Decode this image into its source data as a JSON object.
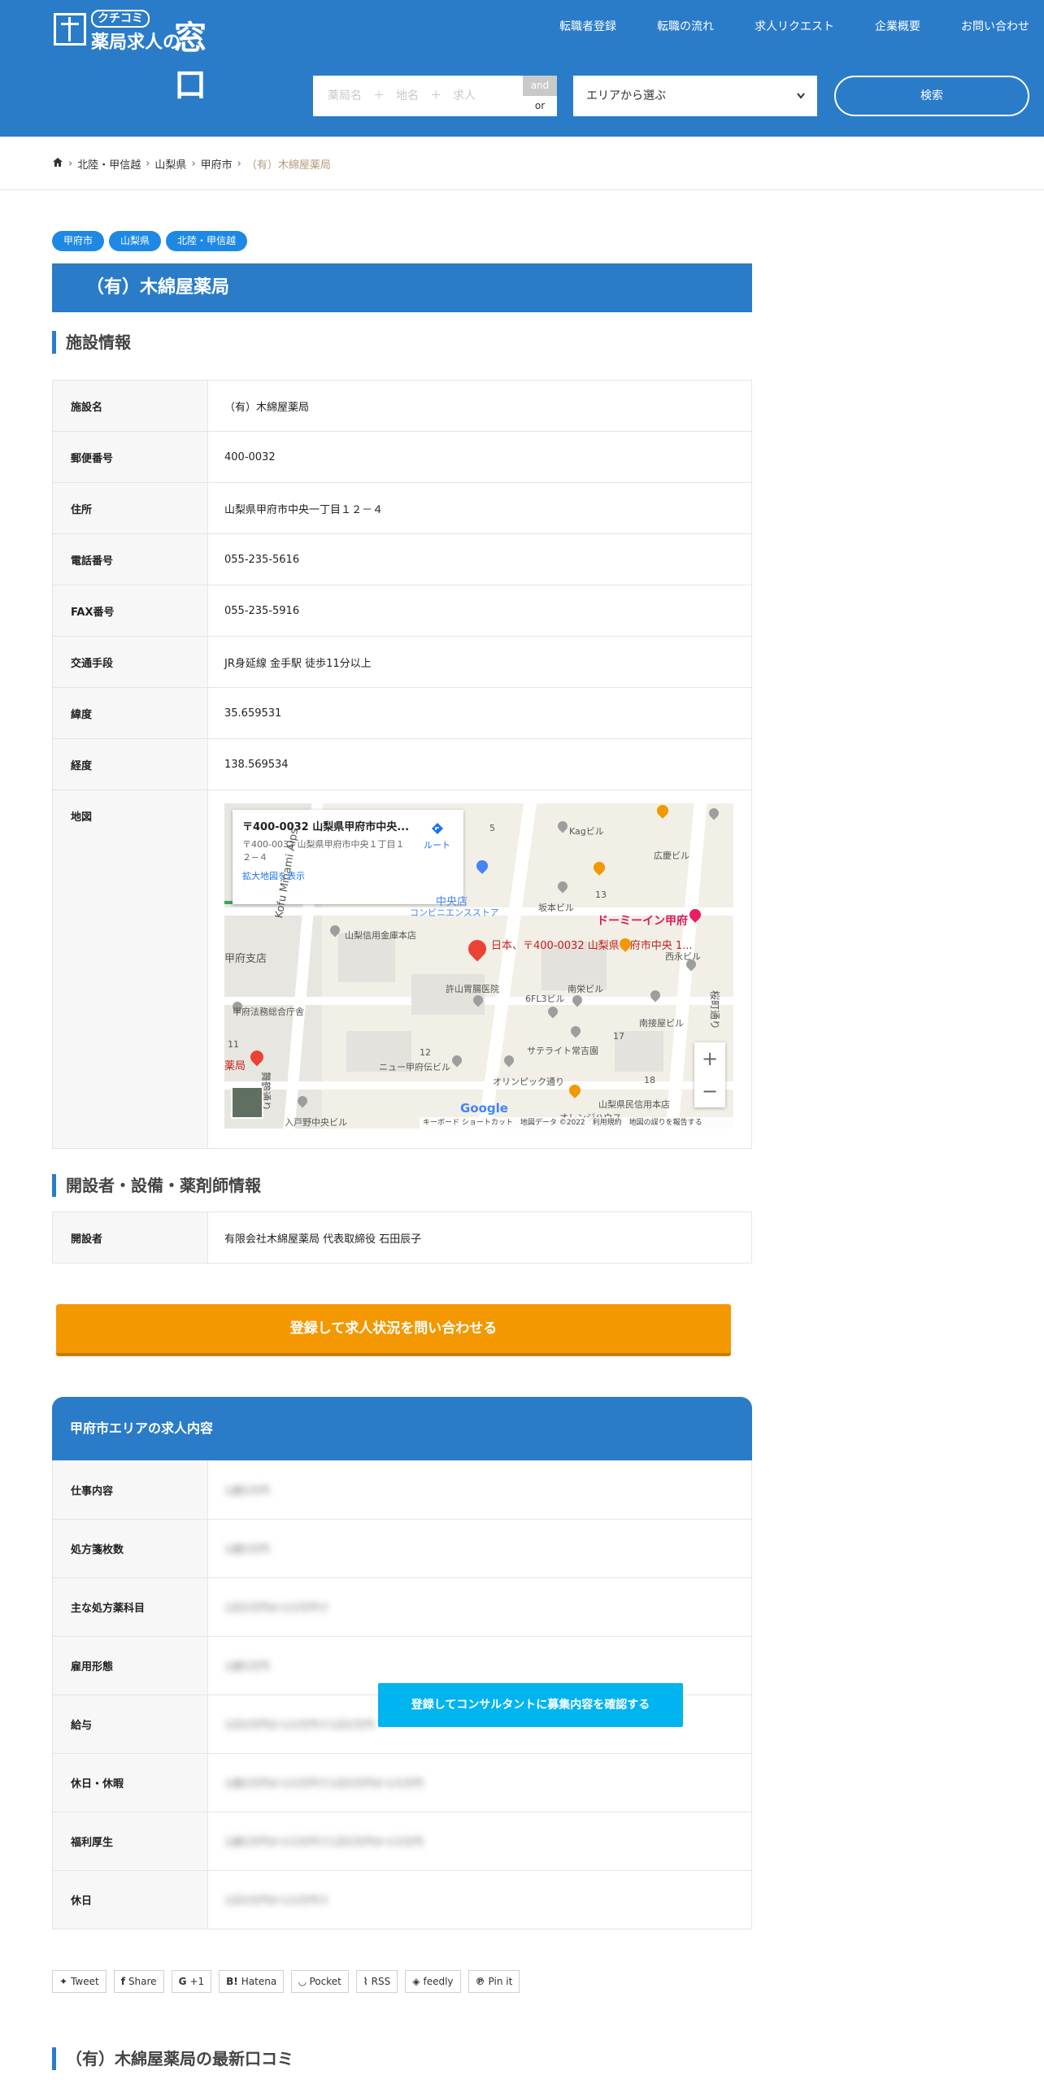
{
  "header": {
    "logo_sub": "クチコミ",
    "logo_main": "薬局求人の",
    "logo_big": "窓口",
    "nav": [
      "転職者登録",
      "転職の流れ",
      "求人リクエスト",
      "企業概要",
      "お問い合わせ"
    ],
    "search_placeholder": "薬局名　＋　地名　＋　求人",
    "and_label": "and",
    "or_label": "or",
    "area_select": "エリアから選ぶ",
    "search_button": "検索"
  },
  "breadcrumb": [
    "北陸・甲信越",
    "山梨県",
    "甲府市",
    "（有）木綿屋薬局"
  ],
  "tags": [
    "甲府市",
    "山梨県",
    "北陸・甲信越"
  ],
  "page_title": "（有）木綿屋薬局",
  "facility": {
    "heading": "施設情報",
    "rows": [
      {
        "key": "施設名",
        "value": "（有）木綿屋薬局"
      },
      {
        "key": "郵便番号",
        "value": "400-0032"
      },
      {
        "key": "住所",
        "value": "山梨県甲府市中央一丁目１２－４"
      },
      {
        "key": "電話番号",
        "value": "055-235-5616"
      },
      {
        "key": "FAX番号",
        "value": "055-235-5916"
      },
      {
        "key": "交通手段",
        "value": "JR身延線 金手駅 徒歩11分以上"
      },
      {
        "key": "緯度",
        "value": "35.659531"
      },
      {
        "key": "経度",
        "value": "138.569534"
      },
      {
        "key": "地図",
        "value": ""
      }
    ]
  },
  "map": {
    "card_title": "〒400-0032 山梨県甲府市中央...",
    "card_address": "〒400-0032 山梨県甲府市中央１丁目１２−４",
    "card_link": "拡大地図を表示",
    "route_label": "ルート",
    "marker_label": "日本、〒400-0032 山梨県甲府市中央 1...",
    "hotel_label": "ドーミーイン甲府",
    "labels": [
      "Kagビル",
      "広慶ビル",
      "坂本ビル",
      "西永ビル",
      "山梨信用金庫本店",
      "許山胃腸医院",
      "6FL3ビル",
      "南栄ビル",
      "南接屋ビル",
      "甲府法務総合庁舎",
      "サテライト常吉園",
      "ニュー甲府伝ビル",
      "オリンピック通り",
      "山梨県民信用本店",
      "オレンジハウス",
      "入戸野中央ビル",
      "Kofu Minami Alps",
      "甲府支店",
      "コンビニエンスストア",
      "中央店",
      "薬局",
      "舞鶴通り",
      "桜町通り",
      "5",
      "13",
      "17",
      "18",
      "12",
      "11"
    ],
    "google": "Google",
    "footer": "キーボード ショートカット　地図データ ©2022　利用規約　地図の誤りを報告する",
    "zoom_in": "+",
    "zoom_out": "−"
  },
  "founder": {
    "heading": "開設者・設備・薬剤師情報",
    "rows": [
      {
        "key": "開設者",
        "value": "有限会社木綿屋薬局 代表取締役 石田辰子"
      }
    ]
  },
  "cta_register": "登録して求人状況を問い合わせる",
  "jobs": {
    "heading": "甲府市エリアの求人内容",
    "rows": [
      {
        "key": "仕事内容",
        "value": "1週5万円"
      },
      {
        "key": "処方箋枚数",
        "value": "1週5万円"
      },
      {
        "key": "主な処方薬科目",
        "value": "1日5万円から5万円で"
      },
      {
        "key": "雇用形態",
        "value": "1週5万円"
      },
      {
        "key": "給与",
        "value": "1日5万円から5万円で1日5万円"
      },
      {
        "key": "休日・休暇",
        "value": "1週5万円から5万円で1日5万円から5万円"
      },
      {
        "key": "福利厚生",
        "value": "1週5万円から5万円で1日5万円から5万円"
      },
      {
        "key": "休日",
        "value": "1日5万円から5万円で"
      }
    ],
    "overlay_button": "登録してコンサルタントに募集内容を確認する"
  },
  "share": [
    {
      "icon": "twitter-icon",
      "label": "Tweet"
    },
    {
      "icon": "facebook-icon",
      "label": "Share"
    },
    {
      "icon": "googleplus-icon",
      "label": "+1"
    },
    {
      "icon": "hatena-icon",
      "label": "Hatena"
    },
    {
      "icon": "pocket-icon",
      "label": "Pocket"
    },
    {
      "icon": "rss-icon",
      "label": "RSS"
    },
    {
      "icon": "feedly-icon",
      "label": "feedly"
    },
    {
      "icon": "pinterest-icon",
      "label": "Pin it"
    }
  ],
  "latest_reviews_heading": "（有）木綿屋薬局の最新口コミ",
  "colors": {
    "brand_blue": "#2a7cc9",
    "cta_orange": "#f39800",
    "overlay_cyan": "#00b4f0"
  }
}
